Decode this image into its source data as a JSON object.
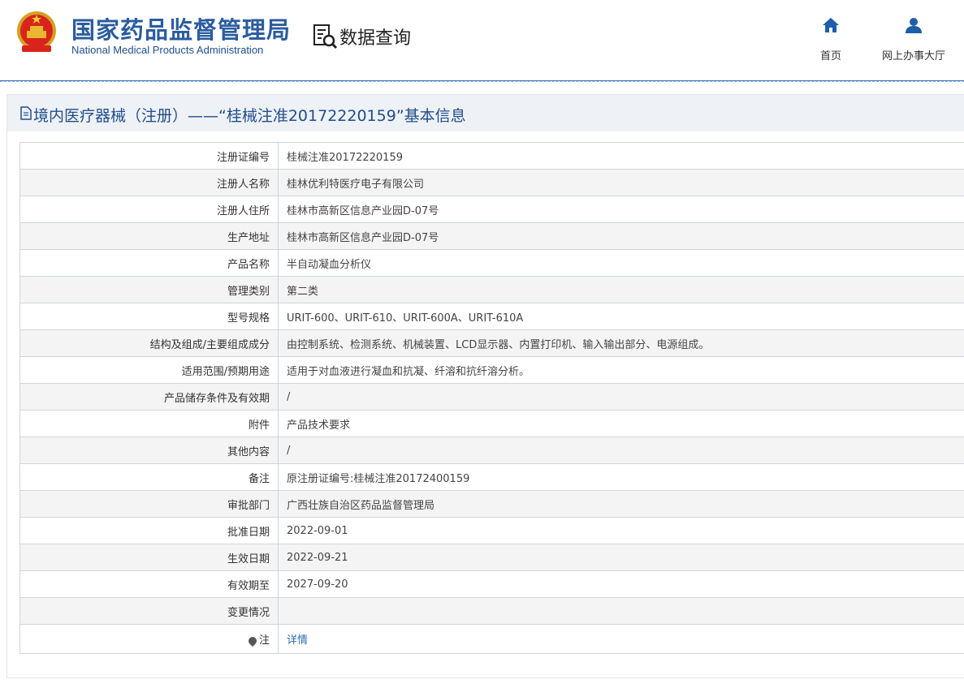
{
  "header": {
    "org_cn": "国家药品监督管理局",
    "org_en": "National Medical Products Administration",
    "query_label": "数据查询",
    "nav": [
      {
        "label": "首页",
        "icon": "home-icon"
      },
      {
        "label": "网上办事大厅",
        "icon": "user-icon"
      }
    ]
  },
  "page": {
    "title": "境内医疗器械（注册）——“桂械注准20172220159”基本信息"
  },
  "rows": [
    {
      "key": "注册证编号",
      "value": "桂械注准20172220159"
    },
    {
      "key": "注册人名称",
      "value": "桂林优利特医疗电子有限公司"
    },
    {
      "key": "注册人住所",
      "value": "桂林市高新区信息产业园D-07号"
    },
    {
      "key": "生产地址",
      "value": "桂林市高新区信息产业园D-07号"
    },
    {
      "key": "产品名称",
      "value": "半自动凝血分析仪"
    },
    {
      "key": "管理类别",
      "value": "第二类"
    },
    {
      "key": "型号规格",
      "value": "URIT-600、URIT-610、URIT-600A、URIT-610A"
    },
    {
      "key": "结构及组成/主要组成成分",
      "value": "由控制系统、检测系统、机械装置、LCD显示器、内置打印机、输入输出部分、电源组成。"
    },
    {
      "key": "适用范围/预期用途",
      "value": "适用于对血液进行凝血和抗凝、纤溶和抗纤溶分析。"
    },
    {
      "key": "产品储存条件及有效期",
      "value": "/"
    },
    {
      "key": "附件",
      "value": "产品技术要求"
    },
    {
      "key": "其他内容",
      "value": "/"
    },
    {
      "key": "备注",
      "value": "原注册证编号:桂械注准20172400159"
    },
    {
      "key": "审批部门",
      "value": "广西壮族自治区药品监督管理局"
    },
    {
      "key": "批准日期",
      "value": "2022-09-01"
    },
    {
      "key": "生效日期",
      "value": "2022-09-21"
    },
    {
      "key": "有效期至",
      "value": "2027-09-20"
    },
    {
      "key": "变更情况",
      "value": ""
    }
  ],
  "note_row": {
    "key": "注",
    "link": "详情"
  },
  "colors": {
    "brand": "#2b5c9f",
    "title_bg": "#eef1f5",
    "link": "#2b6cb5"
  }
}
